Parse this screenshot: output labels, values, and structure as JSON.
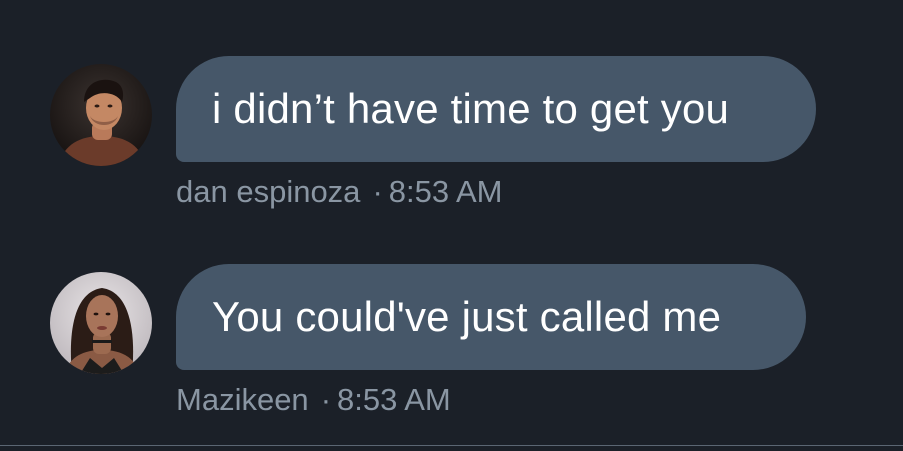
{
  "thread": {
    "messages": [
      {
        "text": "i didn’t have time to get you",
        "sender": "dan espinoza",
        "separator": "·",
        "time": "8:53 AM",
        "avatar_icon": "male-user-avatar"
      },
      {
        "text": "You could've just called me",
        "sender": "Mazikeen",
        "separator": "·",
        "time": "8:53 AM",
        "avatar_icon": "female-user-avatar"
      }
    ]
  },
  "colors": {
    "background": "#1b2028",
    "bubble": "#465769",
    "bubble_text": "#ffffff",
    "meta_text": "#8a96a3"
  }
}
